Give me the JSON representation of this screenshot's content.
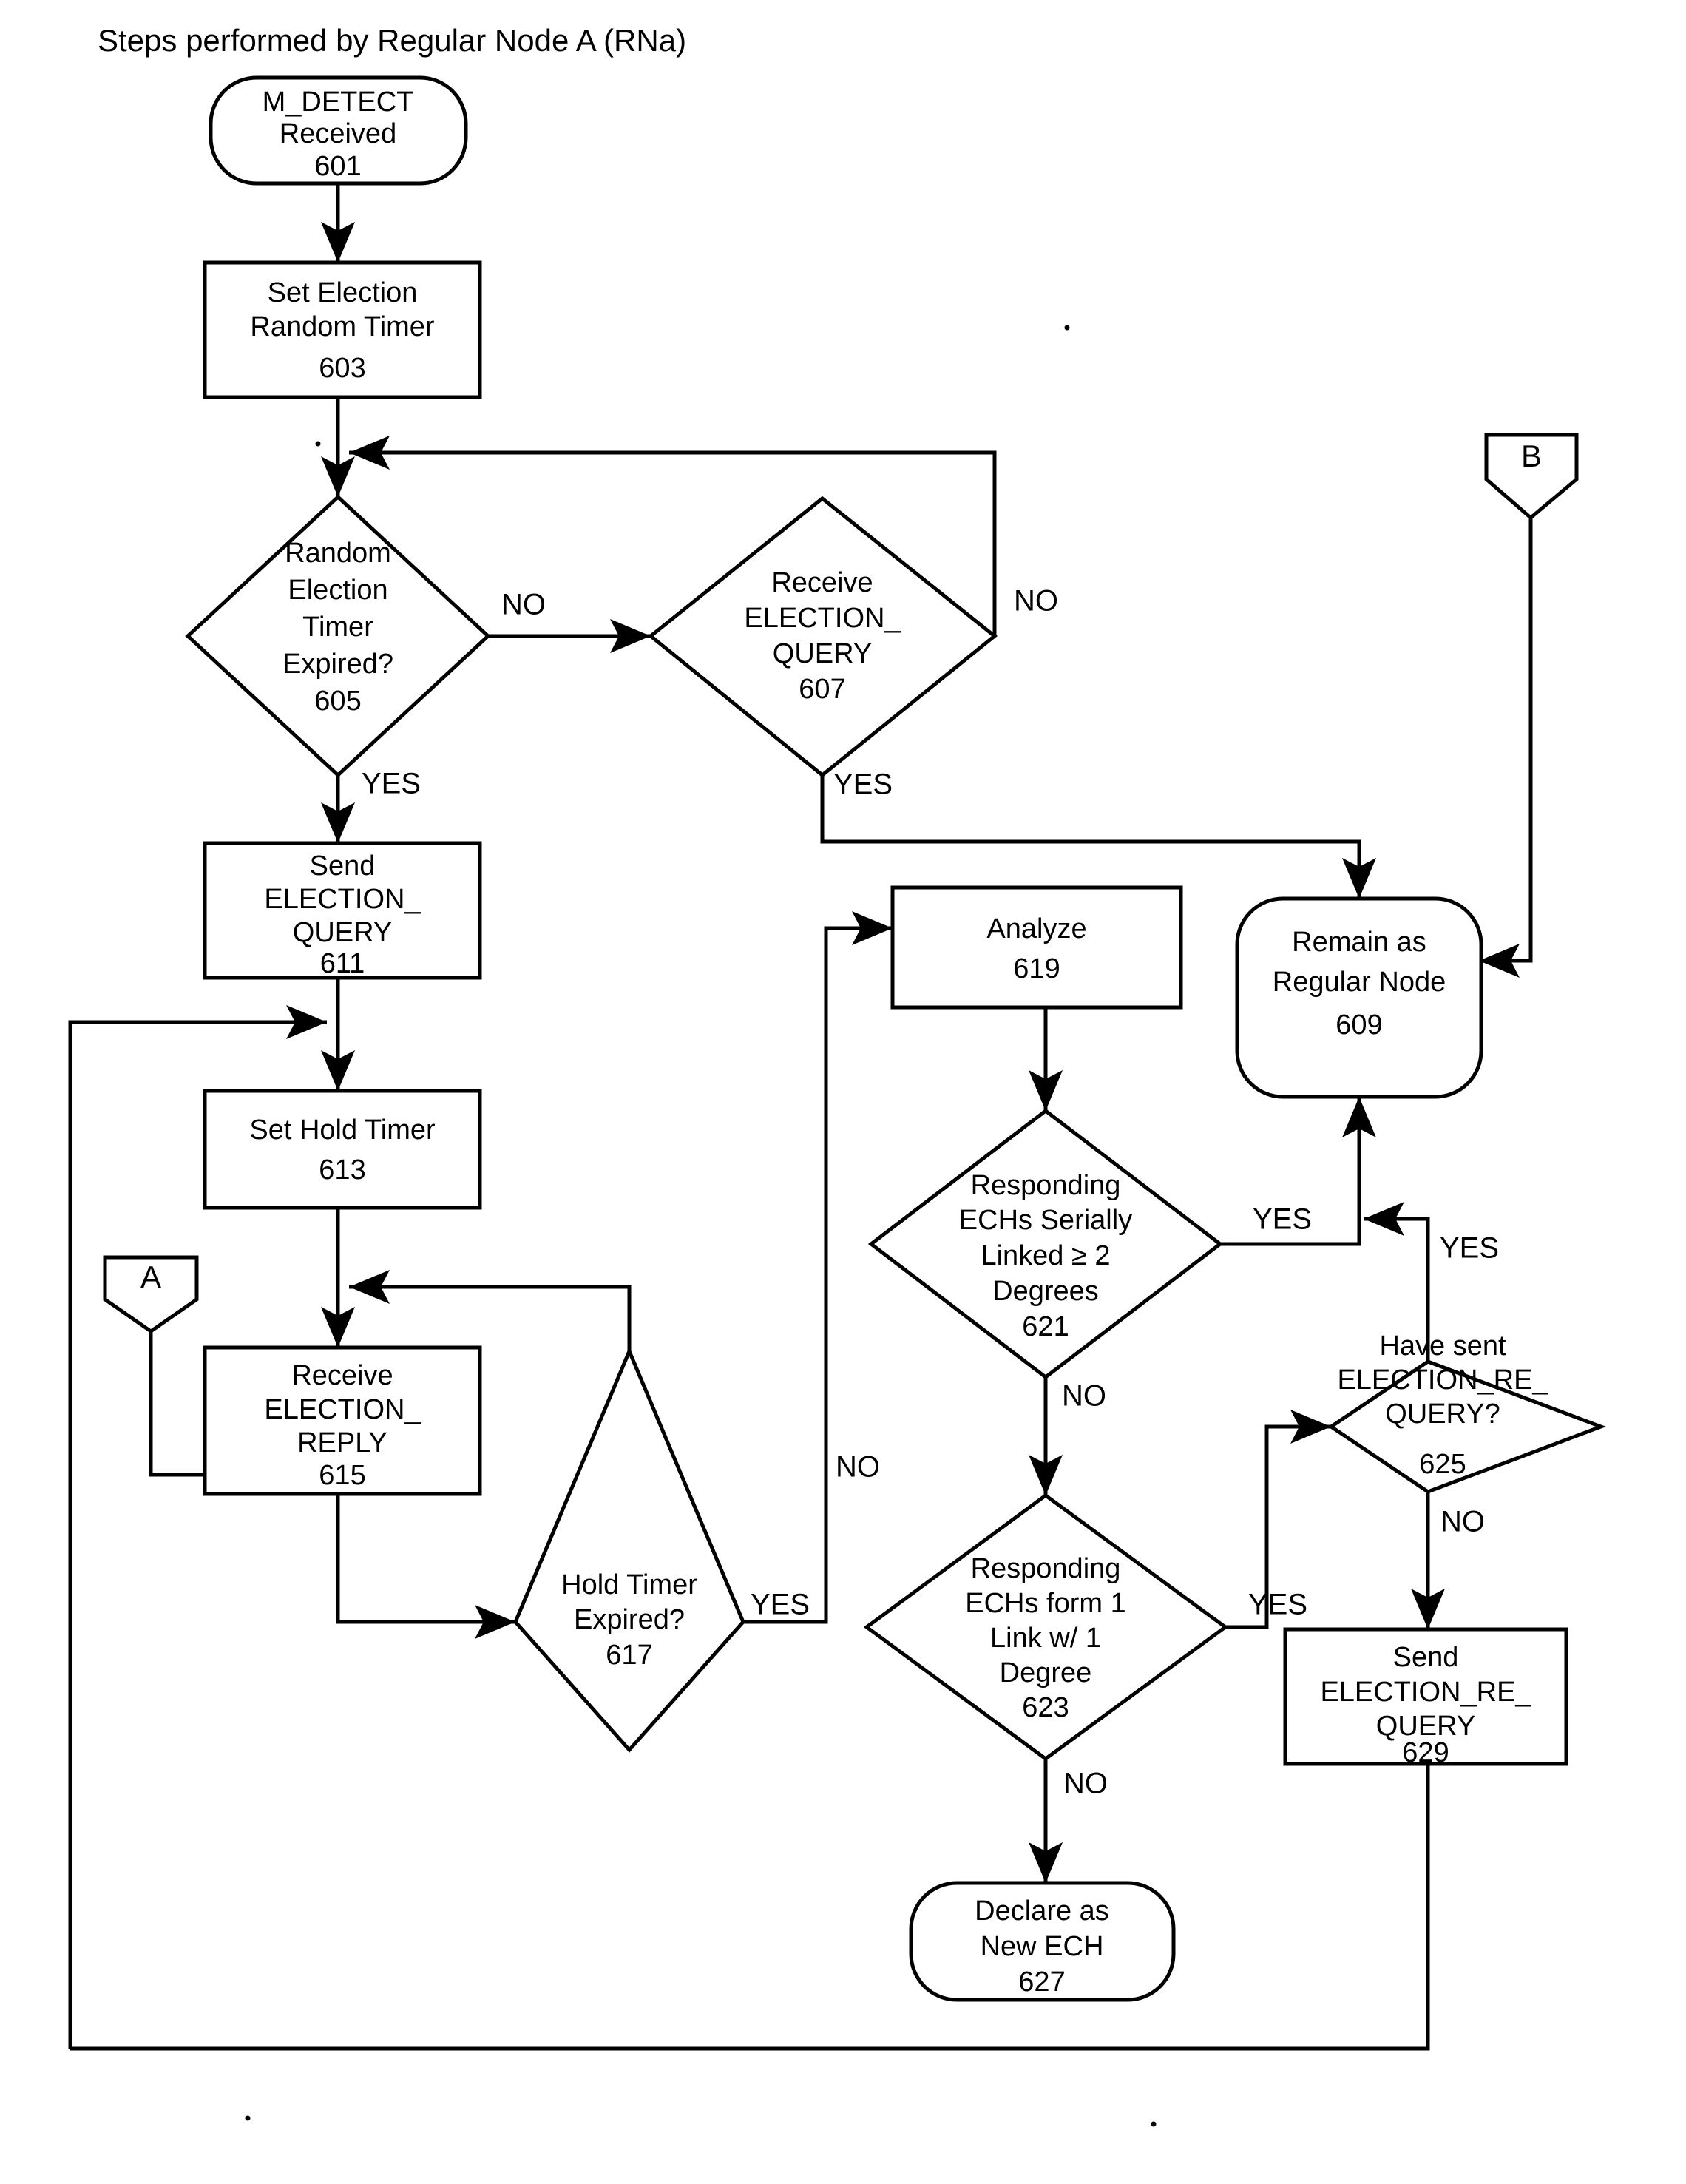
{
  "figure": {
    "title": "Steps performed by Regular Node A (RNa)",
    "kind": "flowchart"
  },
  "nodes": {
    "n601": {
      "shape": "terminator",
      "lines": [
        "M_DETECT",
        "Received",
        "601"
      ],
      "l0": "M_DETECT",
      "l1": "Received",
      "l2": "601"
    },
    "n603": {
      "shape": "process",
      "lines": [
        "Set Election",
        "Random Timer",
        "603"
      ],
      "l0": "Set Election",
      "l1": "Random Timer",
      "l2": "603"
    },
    "n605": {
      "shape": "decision",
      "lines": [
        "Random",
        "Election",
        "Timer",
        "Expired?",
        "605"
      ],
      "l0": "Random",
      "l1": "Election",
      "l2": "Timer",
      "l3": "Expired?",
      "l4": "605"
    },
    "n607": {
      "shape": "decision",
      "lines": [
        "Receive",
        "ELECTION_",
        "QUERY",
        "607"
      ],
      "l0": "Receive",
      "l1": "ELECTION_",
      "l2": "QUERY",
      "l3": "607"
    },
    "n609": {
      "shape": "terminator",
      "lines": [
        "Remain as",
        "Regular Node",
        "609"
      ],
      "l0": "Remain as",
      "l1": "Regular Node",
      "l2": "609"
    },
    "n611": {
      "shape": "process",
      "lines": [
        "Send",
        "ELECTION_",
        "QUERY",
        "611"
      ],
      "l0": "Send",
      "l1": "ELECTION_",
      "l2": "QUERY",
      "l3": "611"
    },
    "n613": {
      "shape": "process",
      "lines": [
        "Set Hold Timer",
        "613"
      ],
      "l0": "Set Hold Timer",
      "l1": "613"
    },
    "n615": {
      "shape": "process",
      "lines": [
        "Receive",
        "ELECTION_",
        "REPLY",
        "615"
      ],
      "l0": "Receive",
      "l1": "ELECTION_",
      "l2": "REPLY",
      "l3": "615"
    },
    "n617": {
      "shape": "decision",
      "lines": [
        "Hold Timer",
        "Expired?",
        "617"
      ],
      "l0": "Hold Timer",
      "l1": "Expired?",
      "l2": "617"
    },
    "n619": {
      "shape": "process",
      "lines": [
        "Analyze",
        "619"
      ],
      "l0": "Analyze",
      "l1": "619"
    },
    "n621": {
      "shape": "decision",
      "lines": [
        "Responding",
        "ECHs Serially",
        "Linked ≥ 2",
        "Degrees",
        "621"
      ],
      "l0": "Responding",
      "l1": "ECHs Serially",
      "l2": "Linked ≥ 2",
      "l3": "Degrees",
      "l4": "621"
    },
    "n623": {
      "shape": "decision",
      "lines": [
        "Responding",
        "ECHs form 1",
        "Link w/ 1",
        "Degree",
        "623"
      ],
      "l0": "Responding",
      "l1": "ECHs form 1",
      "l2": "Link w/ 1",
      "l3": "Degree",
      "l4": "623"
    },
    "n625": {
      "shape": "decision",
      "lines": [
        "Have sent",
        "ELECTION_RE_",
        "QUERY?",
        "625"
      ],
      "l0": "Have sent",
      "l1": "ELECTION_RE_",
      "l2": "QUERY?",
      "l3": "625"
    },
    "n627": {
      "shape": "terminator",
      "lines": [
        "Declare as",
        "New ECH",
        "627"
      ],
      "l0": "Declare as",
      "l1": "New ECH",
      "l2": "627"
    },
    "n629": {
      "shape": "process",
      "lines": [
        "Send",
        "ELECTION_RE_",
        "QUERY",
        "629"
      ],
      "l0": "Send",
      "l1": "ELECTION_RE_",
      "l2": "QUERY",
      "l3": "629"
    }
  },
  "connectors": {
    "a": {
      "letter": "A"
    },
    "b": {
      "letter": "B"
    }
  },
  "edge_labels": {
    "e605_no": "NO",
    "e605_yes": "YES",
    "e607_no": "NO",
    "e607_yes": "YES",
    "e617_no": "NO",
    "e617_yes": "YES",
    "e621_yes": "YES",
    "e621_no": "NO",
    "e623_yes": "YES",
    "e623_no": "NO",
    "e625_yes": "YES",
    "e625_no": "NO"
  },
  "colors": {
    "ink": "#000000",
    "paper": "#ffffff"
  }
}
